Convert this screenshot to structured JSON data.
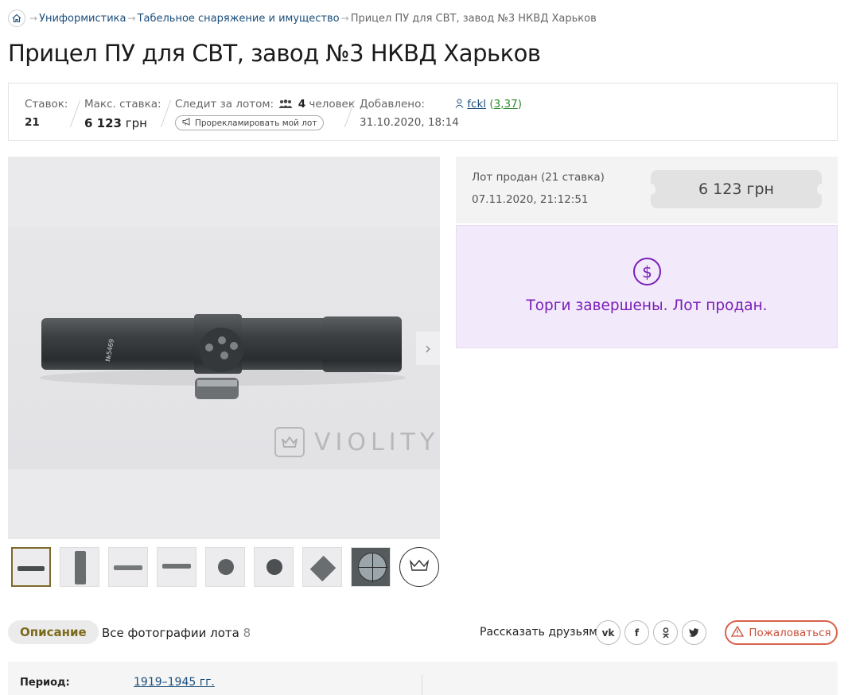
{
  "breadcrumbs": {
    "items": [
      "Униформистика",
      "Табельное снаряжение и имущество"
    ],
    "current": "Прицел ПУ для СВТ, завод №3 НКВД Харьков",
    "separator": "→"
  },
  "lot": {
    "title": "Прицел ПУ для СВТ, завод №3 НКВД Харьков",
    "bids_label": "Ставок:",
    "bids_value": "21",
    "max_bid_label": "Макс. ставка:",
    "max_bid_value": "6 123",
    "max_bid_currency": "грн",
    "watchers_label": "Следит за лотом:",
    "watchers_count": "4",
    "watchers_unit": "человек",
    "promote_label": "Прорекламировать мой лот",
    "added_label": "Добавлено:",
    "added_date": "31.10.2020, 18:14",
    "seller_name": "fckl",
    "seller_rating": "3,37"
  },
  "gallery": {
    "watermark": "VIOLITY",
    "next_symbol": "›",
    "thumbnail_count": 8
  },
  "sale": {
    "status": "Лот продан (21 ставка)",
    "date": "07.11.2020, 21:12:51",
    "price": "6 123 грн",
    "finished_message": "Торги завершены. Лот продан.",
    "icon": "dollar-circle-icon"
  },
  "tabs": {
    "description": "Описание",
    "all_photos": "Все фотографии лота",
    "photos_count": "8"
  },
  "share": {
    "label": "Рассказать друзьям:",
    "networks": [
      "vk-icon",
      "facebook-icon",
      "odnoklassniki-icon",
      "twitter-icon"
    ]
  },
  "report": {
    "label": "Пожаловаться"
  },
  "details": {
    "period_label": "Период:",
    "period_value": "1919–1945 гг."
  },
  "colors": {
    "link": "#1a4d7a",
    "accent_gold": "#7c6a1b",
    "purple": "#7a1fb8",
    "purple_bg": "#f2e9fb",
    "report_red": "#d9634d",
    "rating_green": "#2c8a2c"
  }
}
